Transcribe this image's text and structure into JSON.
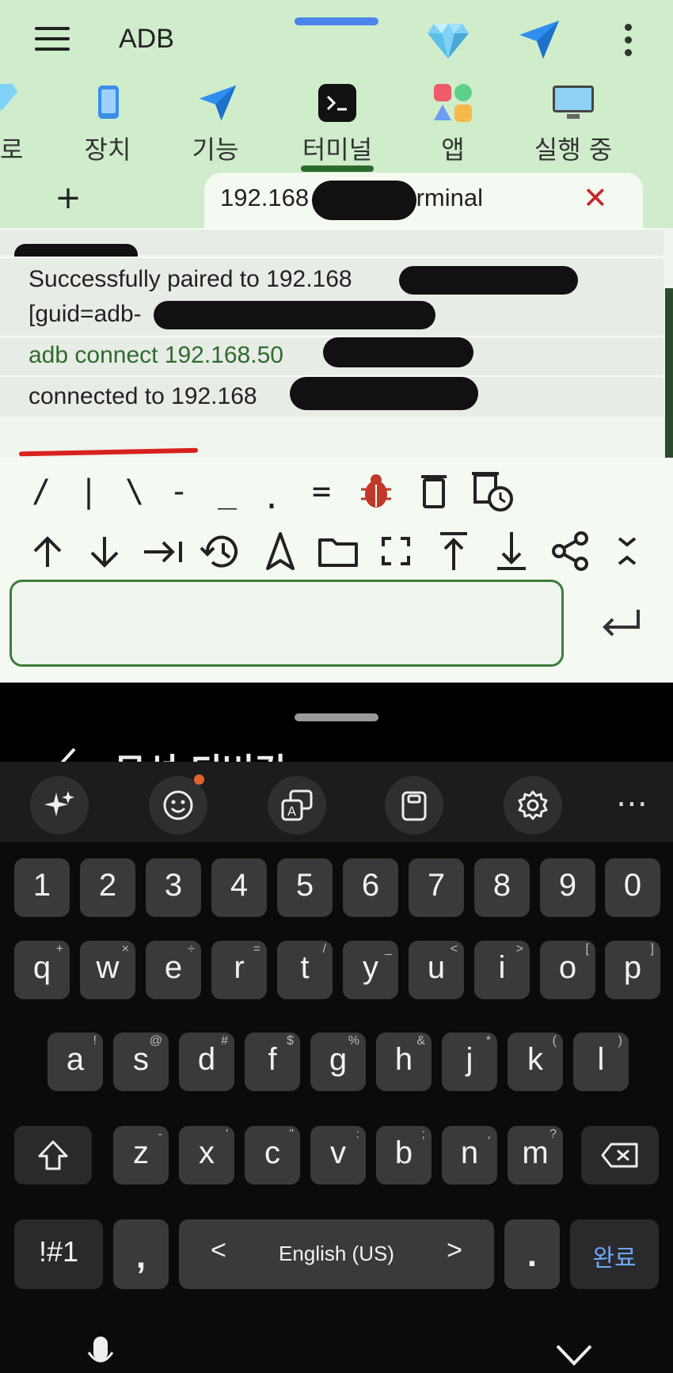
{
  "app": {
    "title": "ADB"
  },
  "tabs": [
    {
      "label": "로",
      "icon": "gem-icon"
    },
    {
      "label": "장치",
      "icon": "phone-icon"
    },
    {
      "label": "기능",
      "icon": "send-icon"
    },
    {
      "label": "터미널",
      "icon": "terminal-icon",
      "selected": true
    },
    {
      "label": "앱",
      "icon": "apps-icon"
    },
    {
      "label": "실행 중",
      "icon": "monitor-icon"
    }
  ],
  "session": {
    "add_label": "+",
    "title": "192.168            Terminal",
    "close_label": "✕"
  },
  "terminal": {
    "lines": [
      {
        "text": "Successfully paired to 192.168",
        "color": "#222222"
      },
      {
        "text": "[guid=adb-",
        "color": "#222222"
      },
      {
        "text": "adb connect 192.168.50",
        "color": "#2e6b2e"
      },
      {
        "text": "connected to 192.168",
        "color": "#222222"
      }
    ]
  },
  "symbols": [
    "/",
    "|",
    "\\",
    "-",
    "_",
    ".",
    "="
  ],
  "symbol_icons": [
    "bug-icon",
    "trash-icon",
    "clear-history-icon"
  ],
  "toolbar_icons": [
    "arrow-up-icon",
    "arrow-down-icon",
    "tab-icon",
    "history-icon",
    "navigate-icon",
    "folder-icon",
    "fullscreen-icon",
    "scroll-top-icon",
    "scroll-bottom-icon",
    "share-icon",
    "collapse-icon"
  ],
  "input": {
    "value": "",
    "placeholder": ""
  },
  "sheet": {
    "peek_title": "무선 디버깅"
  },
  "keyboard": {
    "toolbar": [
      "sparkle-icon",
      "emoji-icon",
      "translate-icon",
      "clipboard-icon",
      "settings-icon",
      "more-icon"
    ],
    "more_label": "⋯",
    "numbers": [
      "1",
      "2",
      "3",
      "4",
      "5",
      "6",
      "7",
      "8",
      "9",
      "0"
    ],
    "row1": [
      {
        "k": "q",
        "a": "+"
      },
      {
        "k": "w",
        "a": "×"
      },
      {
        "k": "e",
        "a": "÷"
      },
      {
        "k": "r",
        "a": "="
      },
      {
        "k": "t",
        "a": "/"
      },
      {
        "k": "y",
        "a": "_"
      },
      {
        "k": "u",
        "a": "<"
      },
      {
        "k": "i",
        "a": ">"
      },
      {
        "k": "o",
        "a": "["
      },
      {
        "k": "p",
        "a": "]"
      }
    ],
    "row2": [
      {
        "k": "a",
        "a": "!"
      },
      {
        "k": "s",
        "a": "@"
      },
      {
        "k": "d",
        "a": "#"
      },
      {
        "k": "f",
        "a": "$"
      },
      {
        "k": "g",
        "a": "%"
      },
      {
        "k": "h",
        "a": "&"
      },
      {
        "k": "j",
        "a": "*"
      },
      {
        "k": "k",
        "a": "("
      },
      {
        "k": "l",
        "a": ")"
      }
    ],
    "row3": [
      {
        "k": "z",
        "a": "-"
      },
      {
        "k": "x",
        "a": "'"
      },
      {
        "k": "c",
        "a": "\""
      },
      {
        "k": "v",
        "a": ":"
      },
      {
        "k": "b",
        "a": ";"
      },
      {
        "k": "n",
        "a": ","
      },
      {
        "k": "m",
        "a": "?"
      }
    ],
    "symbols_label": "!#1",
    "comma_label": ",",
    "space_label": "English (US)",
    "space_left": "<",
    "space_right": ">",
    "period_label": ".",
    "done_label": "완료",
    "done_color": "#6ea8ff"
  }
}
